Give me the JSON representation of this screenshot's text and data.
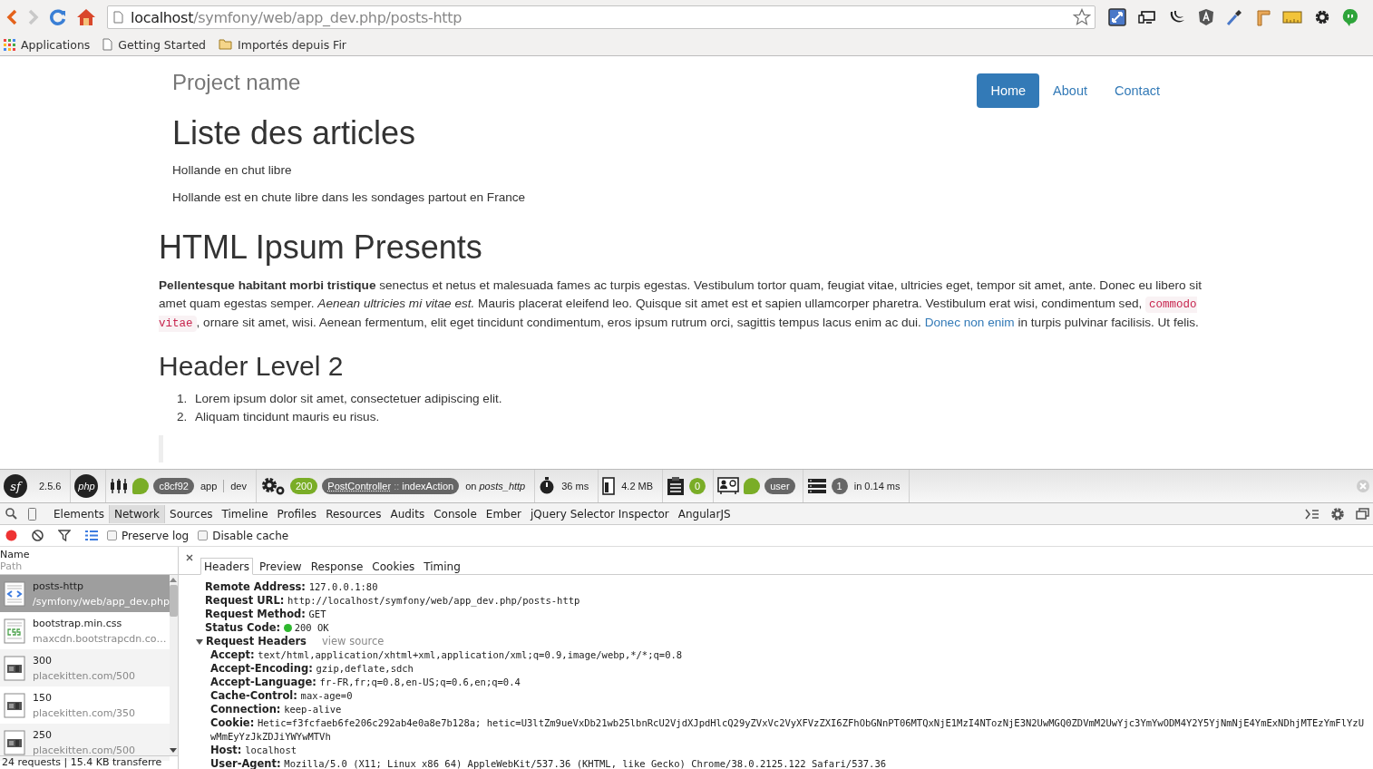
{
  "browser": {
    "url": {
      "host": "localhost",
      "path": "/symfony/web/app_dev.php/posts-http"
    },
    "bookmarks": [
      {
        "label": "Applications",
        "kind": "apps"
      },
      {
        "label": "Getting Started",
        "kind": "page"
      },
      {
        "label": "Importés depuis Fir",
        "kind": "folder"
      }
    ]
  },
  "page": {
    "brand": "Project name",
    "nav": [
      {
        "label": "Home",
        "selected": true
      },
      {
        "label": "About",
        "selected": false
      },
      {
        "label": "Contact",
        "selected": false
      }
    ],
    "title": "Liste des articles",
    "posts": [
      "Hollande en chut libre",
      "Hollande est en chute libre dans les sondages partout en France"
    ],
    "article_title": "HTML Ipsum Presents",
    "paragraph": [
      {
        "kind": "bold",
        "text": "Pellentesque habitant morbi tristique"
      },
      {
        "kind": "text",
        "text": " senectus et netus et malesuada fames ac turpis egestas. Vestibulum tortor quam, feugiat vitae, ultricies eget, tempor sit amet, ante. Donec eu libero sit amet quam egestas semper. "
      },
      {
        "kind": "italic",
        "text": "Aenean ultricies mi vitae est."
      },
      {
        "kind": "text",
        "text": " Mauris placerat eleifend leo. Quisque sit amet est et sapien ullamcorper pharetra. Vestibulum erat wisi, condimentum sed, "
      },
      {
        "kind": "code",
        "text": "commodo vitae"
      },
      {
        "kind": "text",
        "text": ", ornare sit amet, wisi. Aenean fermentum, elit eget tincidunt condimentum, eros ipsum rutrum orci, sagittis tempus lacus enim ac dui. "
      },
      {
        "kind": "link",
        "text": "Donec non enim"
      },
      {
        "kind": "text",
        "text": " in turpis pulvinar facilisis. Ut felis."
      }
    ],
    "subheading": "Header Level 2",
    "list": [
      {
        "number": "1.",
        "text": "Lorem ipsum dolor sit amet, consectetuer adipiscing elit."
      },
      {
        "number": "2.",
        "text": "Aliquam tincidunt mauris eu risus."
      }
    ]
  },
  "profiler": {
    "logo": "sf",
    "version": "2.5.6",
    "php": "php",
    "token": "c8cf92",
    "app": "app",
    "env": "dev",
    "status": "200",
    "controller": "PostController",
    "separator": "::",
    "action": "indexAction",
    "route_prefix": "on",
    "route": "posts_http",
    "time": "36 ms",
    "memory": "4.2 MB",
    "forms": "0",
    "user": "user",
    "queries": "1",
    "query_time": "in 0.14 ms"
  },
  "devtools": {
    "tabs": [
      {
        "label": "Elements",
        "selected": false
      },
      {
        "label": "Network",
        "selected": true
      },
      {
        "label": "Sources",
        "selected": false
      },
      {
        "label": "Timeline",
        "selected": false
      },
      {
        "label": "Profiles",
        "selected": false
      },
      {
        "label": "Resources",
        "selected": false
      },
      {
        "label": "Audits",
        "selected": false
      },
      {
        "label": "Console",
        "selected": false
      },
      {
        "label": "Ember",
        "selected": false
      },
      {
        "label": "jQuery Selector Inspector",
        "selected": false
      },
      {
        "label": "AngularJS",
        "selected": false
      }
    ],
    "options": [
      {
        "label": "Preserve log",
        "checked": false
      },
      {
        "label": "Disable cache",
        "checked": false
      }
    ],
    "columns": {
      "name": "Name",
      "path": "Path"
    },
    "requests": [
      {
        "name": "posts-http",
        "path": "/symfony/web/app_dev.php",
        "kind": "html",
        "selected": true
      },
      {
        "name": "bootstrap.min.css",
        "path": "maxcdn.bootstrapcdn.co…",
        "kind": "css",
        "selected": false
      },
      {
        "name": "300",
        "path": "placekitten.com/500",
        "kind": "image",
        "selected": false
      },
      {
        "name": "150",
        "path": "placekitten.com/350",
        "kind": "image",
        "selected": false
      },
      {
        "name": "250",
        "path": "placekitten.com/500",
        "kind": "image",
        "selected": false
      }
    ],
    "summary": "24 requests  |  15.4 KB transferre",
    "detail_tabs": [
      {
        "label": "Headers",
        "selected": true
      },
      {
        "label": "Preview",
        "selected": false
      },
      {
        "label": "Response",
        "selected": false
      },
      {
        "label": "Cookies",
        "selected": false
      },
      {
        "label": "Timing",
        "selected": false
      }
    ],
    "general": [
      {
        "name": "Remote Address:",
        "value": "127.0.0.1:80"
      },
      {
        "name": "Request URL:",
        "value": "http://localhost/symfony/web/app_dev.php/posts-http"
      },
      {
        "name": "Request Method:",
        "value": "GET"
      },
      {
        "name": "Status Code:",
        "value": "200 OK",
        "color": "#2eb82e"
      }
    ],
    "request_headers": {
      "title": "Request Headers",
      "expanded": true,
      "view_source": "view source",
      "items": [
        {
          "name": "Accept:",
          "value": "text/html,application/xhtml+xml,application/xml;q=0.9,image/webp,*/*;q=0.8"
        },
        {
          "name": "Accept-Encoding:",
          "value": "gzip,deflate,sdch"
        },
        {
          "name": "Accept-Language:",
          "value": "fr-FR,fr;q=0.8,en-US;q=0.6,en;q=0.4"
        },
        {
          "name": "Cache-Control:",
          "value": "max-age=0"
        },
        {
          "name": "Connection:",
          "value": "keep-alive"
        },
        {
          "name": "Cookie:",
          "value": "Hetic=f3fcfaeb6fe206c292ab4e0a8e7b128a; hetic=U3ltZm9ueVxDb21wb25lbnRcU2VjdXJpdHlcQ29yZVxVc2VyXFVzZXI6ZFhObGNnPT06MTQxNjE1MzI4NTozNjE3N2UwMGQ0ZDVmM2UwYjc3YmYwODM4Y2Y5YjNmNjE4YmExNDhjMTEzYmFlYzUwMmEyYzJkZDJiYWYwMTVh"
        },
        {
          "name": "Host:",
          "value": "localhost"
        },
        {
          "name": "User-Agent:",
          "value": "Mozilla/5.0 (X11; Linux x86 64) AppleWebKit/537.36 (KHTML, like Gecko) Chrome/38.0.2125.122 Safari/537.36"
        }
      ]
    }
  }
}
